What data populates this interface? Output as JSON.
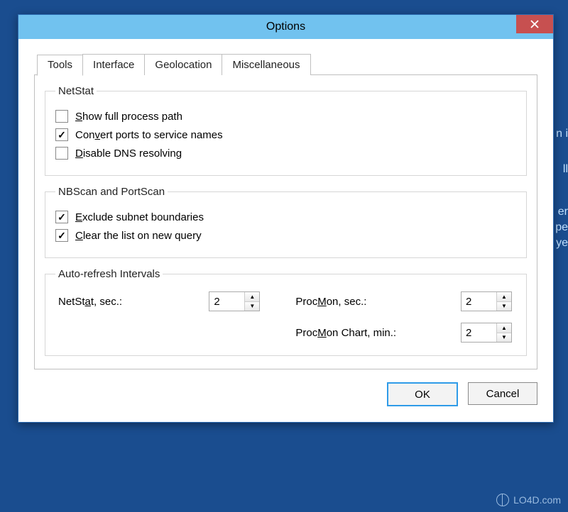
{
  "window": {
    "title": "Options"
  },
  "tabs": [
    {
      "label": "Tools",
      "active": true
    },
    {
      "label": "Interface",
      "active": false
    },
    {
      "label": "Geolocation",
      "active": false
    },
    {
      "label": "Miscellaneous",
      "active": false
    }
  ],
  "netstat_group": {
    "legend": "NetStat",
    "items": [
      {
        "pre": "",
        "key": "S",
        "post": "how full process path",
        "checked": false
      },
      {
        "pre": "Con",
        "key": "v",
        "post": "ert ports to service names",
        "checked": true
      },
      {
        "pre": "",
        "key": "D",
        "post": "isable DNS resolving",
        "checked": false
      }
    ]
  },
  "scan_group": {
    "legend": "NBScan and PortScan",
    "items": [
      {
        "pre": "",
        "key": "E",
        "post": "xclude subnet boundaries",
        "checked": true
      },
      {
        "pre": "",
        "key": "C",
        "post": "lear the list on new query",
        "checked": true
      }
    ]
  },
  "intervals_group": {
    "legend": "Auto-refresh Intervals",
    "netstat": {
      "pre": "NetSt",
      "key": "a",
      "post": "t, sec.:",
      "value": "2"
    },
    "procmon": {
      "pre": "Proc",
      "key": "M",
      "post": "on, sec.:",
      "value": "2"
    },
    "procmon_chart": {
      "pre": "Proc",
      "key": "M",
      "post": "on Chart, min.:",
      "value": "2"
    }
  },
  "buttons": {
    "ok": "OK",
    "cancel": "Cancel"
  },
  "watermark": "LO4D.com",
  "bg_fragments": {
    "f1": "n i",
    "f2": "ll",
    "f3": "er",
    "f4": "pe",
    "f5": "ye"
  }
}
